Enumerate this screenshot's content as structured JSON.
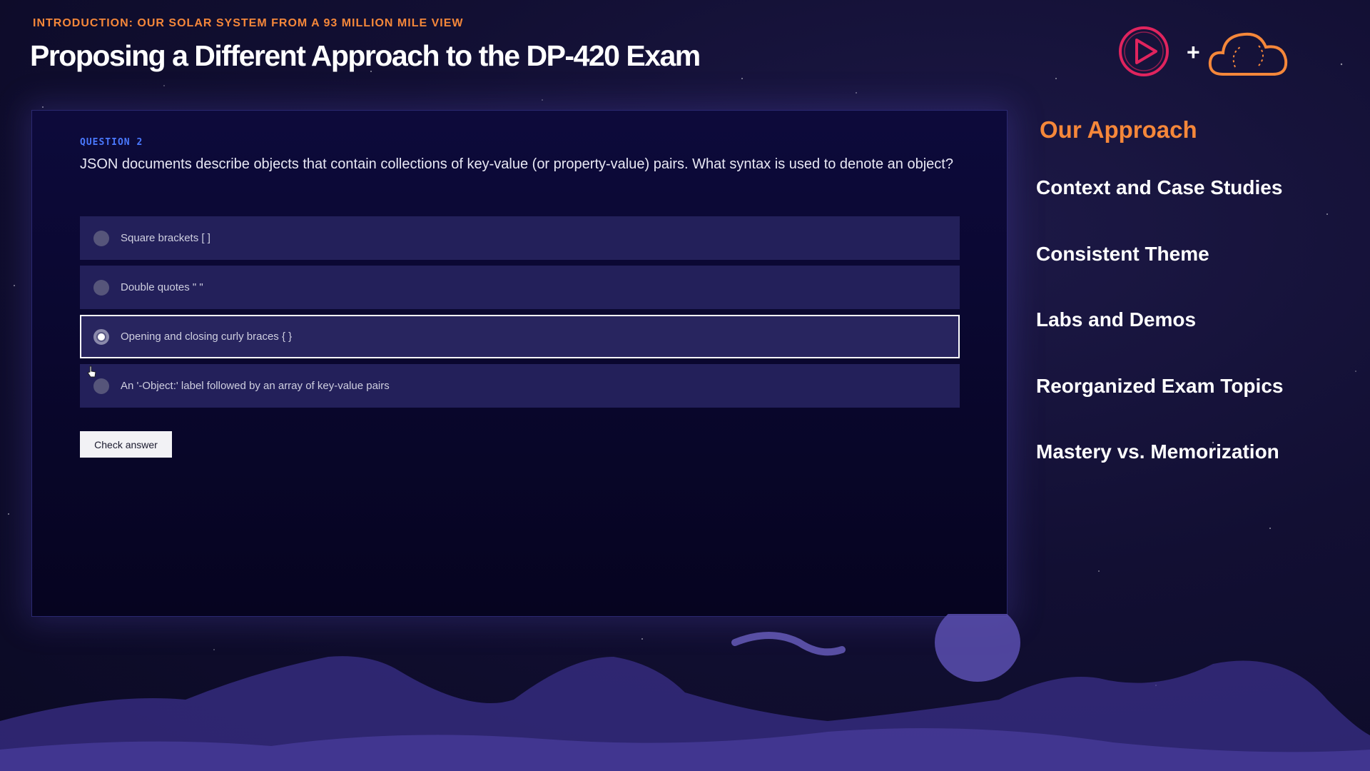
{
  "header": {
    "subtitle": "INTRODUCTION: OUR SOLAR SYSTEM FROM A 93 MILLION MILE VIEW",
    "title": "Proposing a Different Approach to the DP-420 Exam",
    "logos": {
      "play_logo_color": "#e0245e",
      "plus_symbol": "+",
      "cloud_logo_color": "#f5873a"
    }
  },
  "quiz": {
    "question_number": "QUESTION 2",
    "question_text": "JSON documents describe objects that contain collections of key-value (or property-value) pairs. What syntax is used to denote an object?",
    "options": [
      {
        "label": "Square brackets [ ]",
        "selected": false
      },
      {
        "label": "Double quotes \" \"",
        "selected": false
      },
      {
        "label": "Opening and closing curly braces { }",
        "selected": true
      },
      {
        "label": "An '-Object:' label followed by an array of key-value pairs",
        "selected": false
      }
    ],
    "check_button": "Check answer"
  },
  "approach": {
    "heading": "Our Approach",
    "items": [
      "Context and Case Studies",
      "Consistent Theme",
      "Labs and Demos",
      "Reorganized Exam Topics",
      "Mastery vs. Memorization"
    ]
  },
  "colors": {
    "accent_orange": "#f5873a",
    "question_number_blue": "#4a79ff",
    "background": "#120f33",
    "option_bg": "#23205a"
  }
}
